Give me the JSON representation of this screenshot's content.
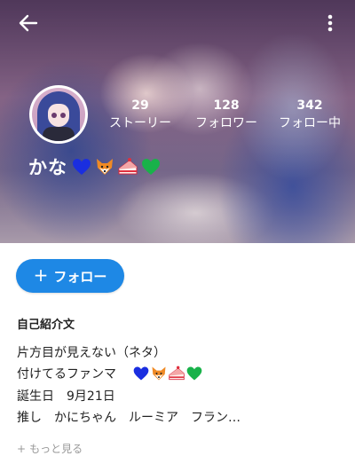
{
  "profile": {
    "name": "かな",
    "name_emojis": [
      "blue-heart",
      "fox",
      "cake",
      "green-heart"
    ]
  },
  "stats": {
    "stories": {
      "count": "29",
      "label": "ストーリー"
    },
    "followers": {
      "count": "128",
      "label": "フォロワー"
    },
    "following": {
      "count": "342",
      "label": "フォロー中"
    }
  },
  "actions": {
    "follow_icon": "+",
    "follow_label": "フォロー"
  },
  "bio": {
    "title": "自己紹介文",
    "line1": "片方目が見えない（ネタ）",
    "line2": "付けてるファンマ",
    "line3": "誕生日　9月21日",
    "line4": "推し　かにちゃん　ルーミア　フラン…",
    "more_icon": "+",
    "more_label": "もっと見る"
  },
  "colors": {
    "accent": "#1e88e5",
    "heart_blue": "#1a2ee0",
    "heart_green": "#19b24a",
    "fox": "#f08a24"
  }
}
